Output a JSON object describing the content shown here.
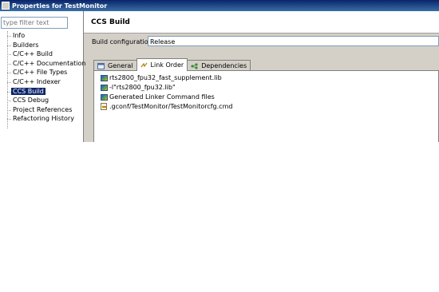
{
  "window": {
    "title": "Properties for TestMonitor"
  },
  "sidebar": {
    "filter_placeholder": "type filter text",
    "items": [
      {
        "label": "Info"
      },
      {
        "label": "Builders"
      },
      {
        "label": "C/C++ Build"
      },
      {
        "label": "C/C++ Documentation"
      },
      {
        "label": "C/C++ File Types"
      },
      {
        "label": "C/C++ Indexer"
      },
      {
        "label": "CCS Build",
        "selected": true
      },
      {
        "label": "CCS Debug"
      },
      {
        "label": "Project References"
      },
      {
        "label": "Refactoring History"
      }
    ]
  },
  "main": {
    "title": "CCS Build",
    "config_label": "Build configuration:",
    "config_value": "Release",
    "tabs": [
      {
        "label": "General",
        "icon": "general-icon"
      },
      {
        "label": "Link Order",
        "icon": "link-order-icon",
        "active": true
      },
      {
        "label": "Dependencies",
        "icon": "dependencies-icon"
      }
    ],
    "link_order": [
      {
        "label": "rts2800_fpu32_fast_supplement.lib",
        "icon": "library-icon"
      },
      {
        "label": "-l\"rts2800_fpu32.lib\"",
        "icon": "library-icon"
      },
      {
        "label": "Generated Linker Command files",
        "icon": "library-icon"
      },
      {
        "label": ".gconf/TestMonitor/TestMonitorcfg.cmd",
        "icon": "cmd-file-icon"
      }
    ]
  },
  "colors": {
    "titlebar": "#0a246a",
    "panel": "#d4d0c8",
    "selection": "#0a246a"
  }
}
